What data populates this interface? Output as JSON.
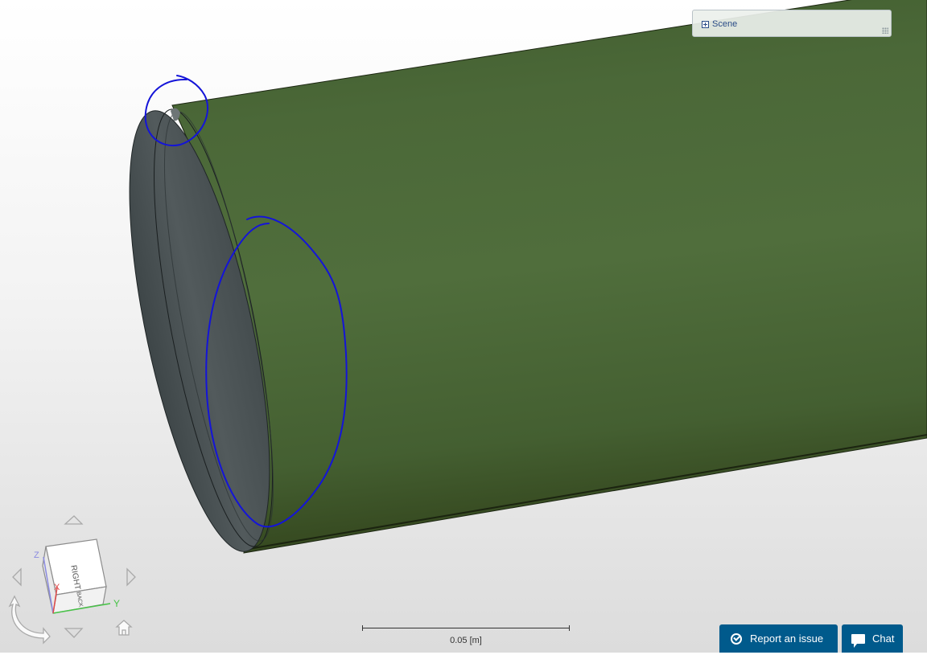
{
  "scene_panel": {
    "toggle_icon": "plus-box-icon",
    "label": "Scene"
  },
  "scale_bar": {
    "label": "0.05 [m]"
  },
  "buttons": {
    "report_issue": "Report an issue",
    "report_icon": "check-circle-icon",
    "chat": "Chat",
    "chat_icon": "speech-bubble-icon"
  },
  "nav_cube": {
    "face_front": "RIGHT",
    "face_bottom": "BACK",
    "axis_x": "X",
    "axis_y": "Y",
    "axis_z": "Z"
  },
  "colors": {
    "cylinder": "#4d6a3a",
    "end_cap": "#4d5557",
    "annotation": "#1414d8",
    "button": "#005a8c"
  }
}
